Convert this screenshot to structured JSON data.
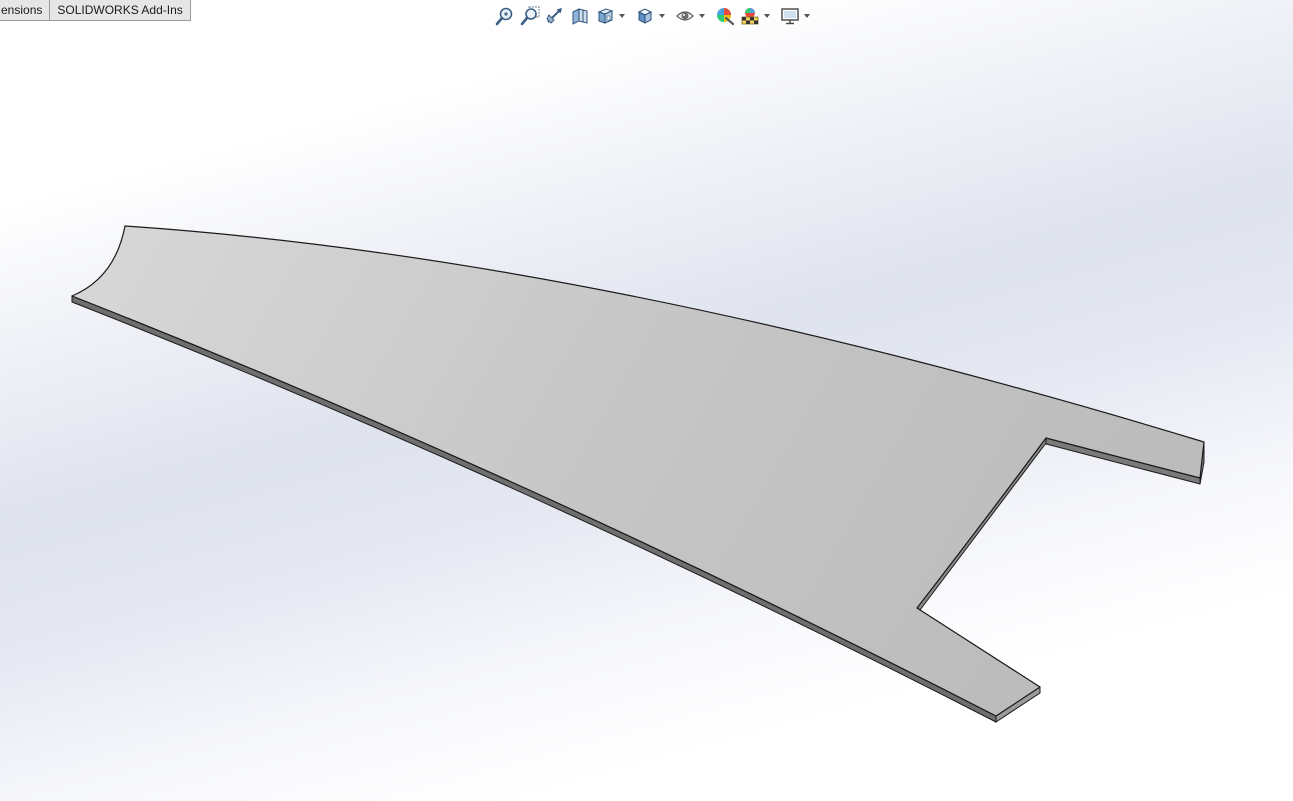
{
  "command_manager": {
    "tabs": [
      {
        "label": "ensions"
      },
      {
        "label": "SOLIDWORKS Add-Ins"
      }
    ]
  },
  "heads_up_toolbar": {
    "tools": [
      {
        "icon": "zoom-to-fit-icon"
      },
      {
        "icon": "zoom-to-area-icon"
      },
      {
        "icon": "previous-view-icon"
      },
      {
        "icon": "section-view-icon"
      },
      {
        "icon": "view-orientation-icon",
        "has_dropdown": true
      },
      {
        "icon": "display-style-icon",
        "has_dropdown": true
      },
      {
        "icon": "hide-show-items-icon",
        "has_dropdown": true
      },
      {
        "icon": "edit-appearance-icon"
      },
      {
        "icon": "apply-scene-icon",
        "has_dropdown": true
      },
      {
        "icon": "view-settings-icon",
        "has_dropdown": true
      }
    ]
  },
  "graphics_area": {
    "part": "sheet-plate-body",
    "colors": {
      "face_light": "#d6d6d6",
      "face_dark": "#bdbdbd",
      "edge_side": "#7a7a7a",
      "outline": "#1a1a1a"
    }
  }
}
